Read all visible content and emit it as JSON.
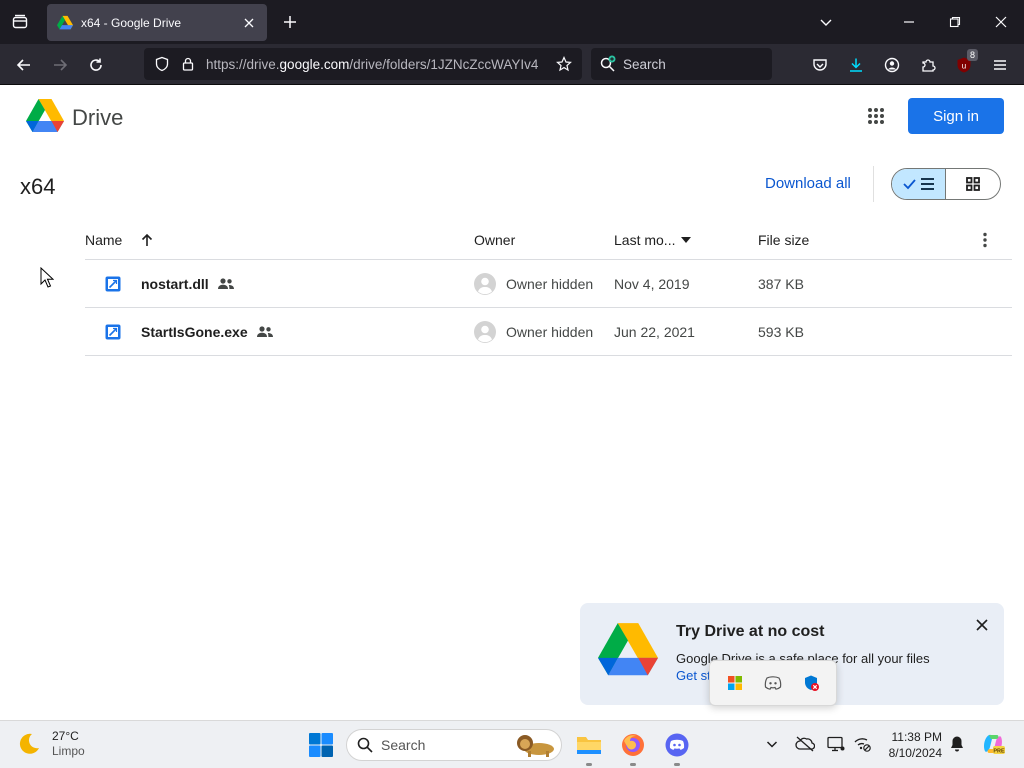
{
  "browser": {
    "tab": {
      "title": "x64 - Google Drive"
    },
    "url": {
      "prefix": "https://drive.",
      "domain": "google.com",
      "path": "/drive/folders/1JZNcZccWAYIv4"
    },
    "search_label": "Search",
    "extension_badge": "8"
  },
  "drive": {
    "app_name": "Drive",
    "sign_in_label": "Sign in",
    "folder_title": "x64",
    "download_all_label": "Download all",
    "columns": {
      "name": "Name",
      "owner": "Owner",
      "last_modified": "Last mo...",
      "file_size": "File size"
    },
    "files": [
      {
        "name": "nostart.dll",
        "owner": "Owner hidden",
        "modified": "Nov 4, 2019",
        "size": "387 KB"
      },
      {
        "name": "StartIsGone.exe",
        "owner": "Owner hidden",
        "modified": "Jun 22, 2021",
        "size": "593 KB"
      }
    ],
    "promo": {
      "title": "Try Drive at no cost",
      "text": "Google Drive is a safe place for all your files",
      "link": "Get st"
    }
  },
  "taskbar": {
    "weather": {
      "temp": "27°C",
      "condition": "Limpo"
    },
    "search_label": "Search",
    "clock": {
      "time": "11:38 PM",
      "date": "8/10/2024"
    }
  },
  "colors": {
    "accent": "#1a73e8",
    "link": "#0b57d0",
    "toggle_active": "#c2e7ff",
    "browser_dark": "#1c1b22",
    "toolbar": "#2b2a33"
  }
}
